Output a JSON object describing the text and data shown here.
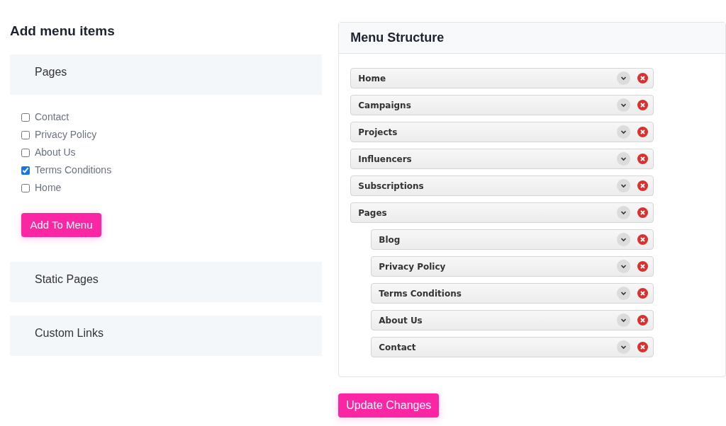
{
  "add_menu": {
    "title": "Add menu items",
    "sections": [
      {
        "title": "Pages",
        "items": [
          {
            "label": "Contact",
            "checked": false
          },
          {
            "label": "Privacy Policy",
            "checked": false
          },
          {
            "label": "About Us",
            "checked": false
          },
          {
            "label": "Terms Conditions",
            "checked": true
          },
          {
            "label": "Home",
            "checked": false
          }
        ],
        "button": "Add To Menu"
      },
      {
        "title": "Static Pages"
      },
      {
        "title": "Custom Links"
      }
    ]
  },
  "menu_structure": {
    "title": "Menu Structure",
    "items": [
      {
        "label": "Home"
      },
      {
        "label": "Campaigns"
      },
      {
        "label": "Projects"
      },
      {
        "label": "Influencers"
      },
      {
        "label": "Subscriptions"
      },
      {
        "label": "Pages",
        "children": [
          {
            "label": "Blog"
          },
          {
            "label": "Privacy Policy"
          },
          {
            "label": "Terms Conditions"
          },
          {
            "label": "About Us"
          },
          {
            "label": "Contact"
          }
        ]
      }
    ]
  },
  "update_button": "Update Changes"
}
